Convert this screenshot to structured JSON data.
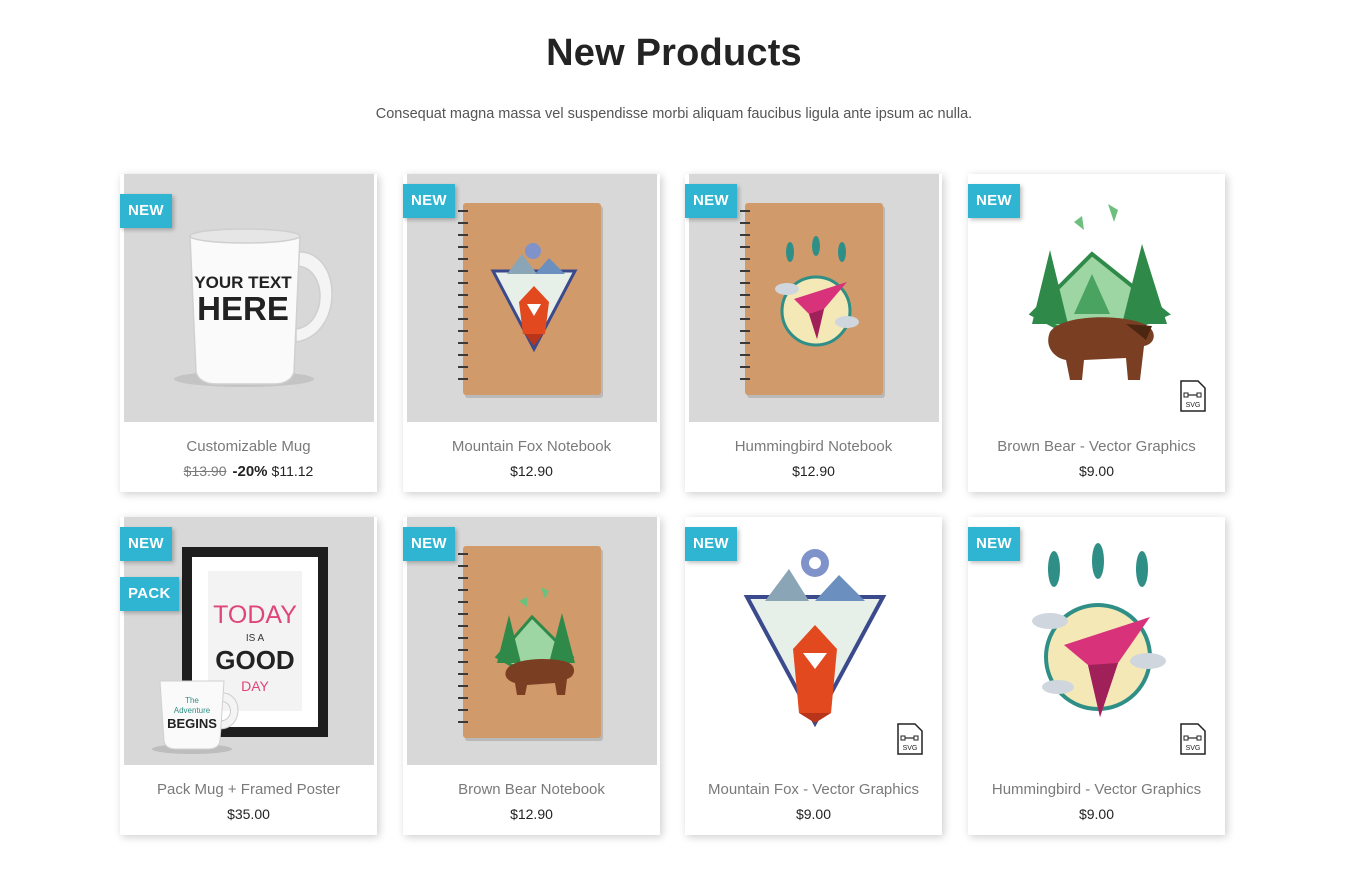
{
  "section": {
    "title": "New Products",
    "subtitle": "Consequat magna massa vel suspendisse morbi aliquam faucibus ligula ante ipsum ac nulla."
  },
  "products": [
    {
      "name": "Customizable Mug",
      "flags": [
        "NEW"
      ],
      "regular_price": "$13.90",
      "discount": "-20%",
      "price": "$11.12",
      "image": "mug-image",
      "mug_text": [
        "YOUR TEXT",
        "HERE"
      ]
    },
    {
      "name": "Mountain Fox Notebook",
      "flags": [
        "NEW"
      ],
      "price": "$12.90",
      "image": "fox-notebook-image"
    },
    {
      "name": "Hummingbird Notebook",
      "flags": [
        "NEW"
      ],
      "price": "$12.90",
      "image": "hummingbird-notebook-image"
    },
    {
      "name": "Brown Bear - Vector Graphics",
      "flags": [
        "NEW"
      ],
      "price": "$9.00",
      "image": "bear-vector-image",
      "svg_label": "SVG"
    },
    {
      "name": "Pack Mug + Framed Poster",
      "flags": [
        "NEW",
        "PACK"
      ],
      "price": "$35.00",
      "image": "pack-poster-image",
      "poster_text": [
        "TODAY",
        "IS A",
        "GOOD",
        "DAY"
      ],
      "mug_text": [
        "The",
        "Adventure",
        "BEGINS"
      ]
    },
    {
      "name": "Brown Bear Notebook",
      "flags": [
        "NEW"
      ],
      "price": "$12.90",
      "image": "bear-notebook-image"
    },
    {
      "name": "Mountain Fox - Vector Graphics",
      "flags": [
        "NEW"
      ],
      "price": "$9.00",
      "image": "fox-vector-image",
      "svg_label": "SVG"
    },
    {
      "name": "Hummingbird - Vector Graphics",
      "flags": [
        "NEW"
      ],
      "price": "$9.00",
      "image": "hummingbird-vector-image",
      "svg_label": "SVG"
    }
  ],
  "colors": {
    "flag": "#2fb5d2",
    "text": "#232323",
    "muted": "#7a7a7a"
  }
}
